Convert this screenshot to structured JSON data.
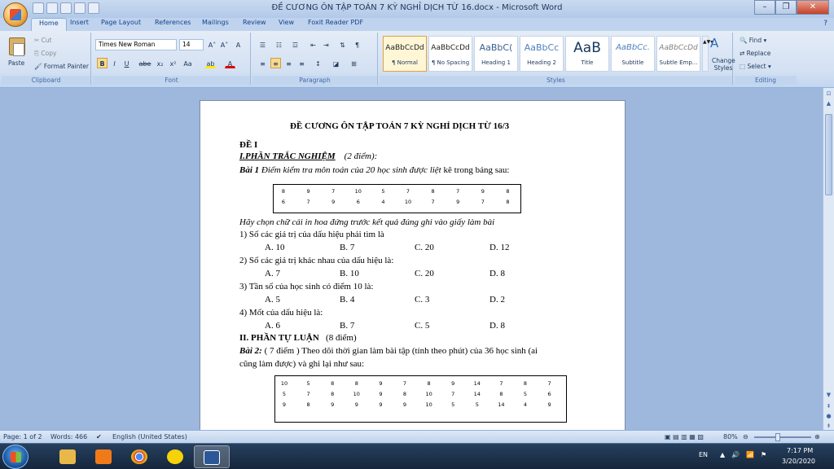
{
  "window": {
    "title": "ĐỀ CƯƠNG ÔN TẬP TOÁN 7 KỲ NGHỈ DỊCH TỪ 16.docx - Microsoft Word"
  },
  "tabs": [
    "Home",
    "Insert",
    "Page Layout",
    "References",
    "Mailings",
    "Review",
    "View",
    "Foxit Reader PDF"
  ],
  "clipboard": {
    "paste": "Paste",
    "cut": "Cut",
    "copy": "Copy",
    "format_painter": "Format Painter",
    "label": "Clipboard"
  },
  "font": {
    "name": "Times New Roman",
    "size": "14",
    "label": "Font",
    "bold": "B",
    "italic": "I",
    "underline": "U",
    "strike": "abe",
    "sub": "x₂",
    "sup": "x²",
    "case": "Aa",
    "grow": "A˄",
    "shrink": "A˅",
    "clear": "A",
    "highlight": "ab",
    "color": "A"
  },
  "paragraph": {
    "label": "Paragraph"
  },
  "styles": {
    "label": "Styles",
    "items": [
      {
        "preview": "AaBbCcDd",
        "name": "¶ Normal"
      },
      {
        "preview": "AaBbCcDd",
        "name": "¶ No Spacing"
      },
      {
        "preview": "AaBbC(",
        "name": "Heading 1"
      },
      {
        "preview": "AaBbCc",
        "name": "Heading 2"
      },
      {
        "preview": "AaB",
        "name": "Title"
      },
      {
        "preview": "AaBbCc.",
        "name": "Subtitle"
      },
      {
        "preview": "AaBbCcDd",
        "name": "Subtle Emp..."
      }
    ],
    "change": "Change Styles"
  },
  "editing": {
    "find": "Find",
    "replace": "Replace",
    "select": "Select",
    "label": "Editing"
  },
  "doc": {
    "title": "ĐỀ CƯƠNG ÔN TẬP TOÁN 7 KỲ NGHỈ DỊCH TỪ 16/3",
    "de": "ĐỀ I",
    "part1": "I.PHẦN TRẮC NGHIỆM",
    "part1_pts": "(2 điểm):",
    "bai1_label": "Bài 1",
    "bai1_text": "Điểm kiểm tra môn toán của 20 học sinh được liệt",
    "bai1_tail": "kê trong bảng sau:",
    "table1": [
      [
        "8",
        "9",
        "7",
        "10",
        "5",
        "7",
        "8",
        "7",
        "9",
        "8"
      ],
      [
        "6",
        "7",
        "9",
        "6",
        "4",
        "10",
        "7",
        "9",
        "7",
        "8"
      ]
    ],
    "instruction": "Hãy chọn chữ cái in hoa đứng trước  kết quả đúng ghi vào giấy làm bài",
    "questions": [
      {
        "q": "1) Số các giá trị của dấu hiệu phải tìm là",
        "a": "A. 10",
        "b": "B. 7",
        "c": "C. 20",
        "d": "D. 12"
      },
      {
        "q": "2) Số các giá trị khác nhau của dấu hiệu là:",
        "a": "A. 7",
        "b": "B. 10",
        "c": "C. 20",
        "d": "D. 8"
      },
      {
        "q": "3) Tần số của học sinh có điểm 10 là:",
        "a": "A. 5",
        "b": "B. 4",
        "c": "C. 3",
        "d": "D. 2"
      },
      {
        "q": "4) Mốt  của dấu hiệu là:",
        "a": "A. 6",
        "b": "B. 7",
        "c": "C. 5",
        "d": "D. 8"
      }
    ],
    "part2": "II. PHẦN TỰ LUẬN",
    "part2_pts": "(8 điểm)",
    "bai2_label": "Bài 2:",
    "bai2_text": "( 7 điểm )  Theo dõi thời gian làm bài tập (tính theo phút) của 36 học sinh (ai",
    "bai2_text2": "cũng làm được) và ghi lại như sau:",
    "table2": [
      [
        "10",
        "5",
        "8",
        "8",
        "9",
        "7",
        "8",
        "9",
        "14",
        "7",
        "8",
        "7"
      ],
      [
        "5",
        "7",
        "8",
        "10",
        "9",
        "8",
        "10",
        "7",
        "14",
        "8",
        "5",
        "6"
      ],
      [
        "9",
        "8",
        "9",
        "9",
        "9",
        "9",
        "10",
        "5",
        "5",
        "14",
        "4",
        "9"
      ]
    ]
  },
  "status": {
    "page": "Page: 1 of 2",
    "words": "Words: 466",
    "language": "English (United States)",
    "zoom": "80%"
  },
  "taskbar": {
    "lang": "EN",
    "time": "7:17 PM",
    "date": "3/20/2020"
  }
}
